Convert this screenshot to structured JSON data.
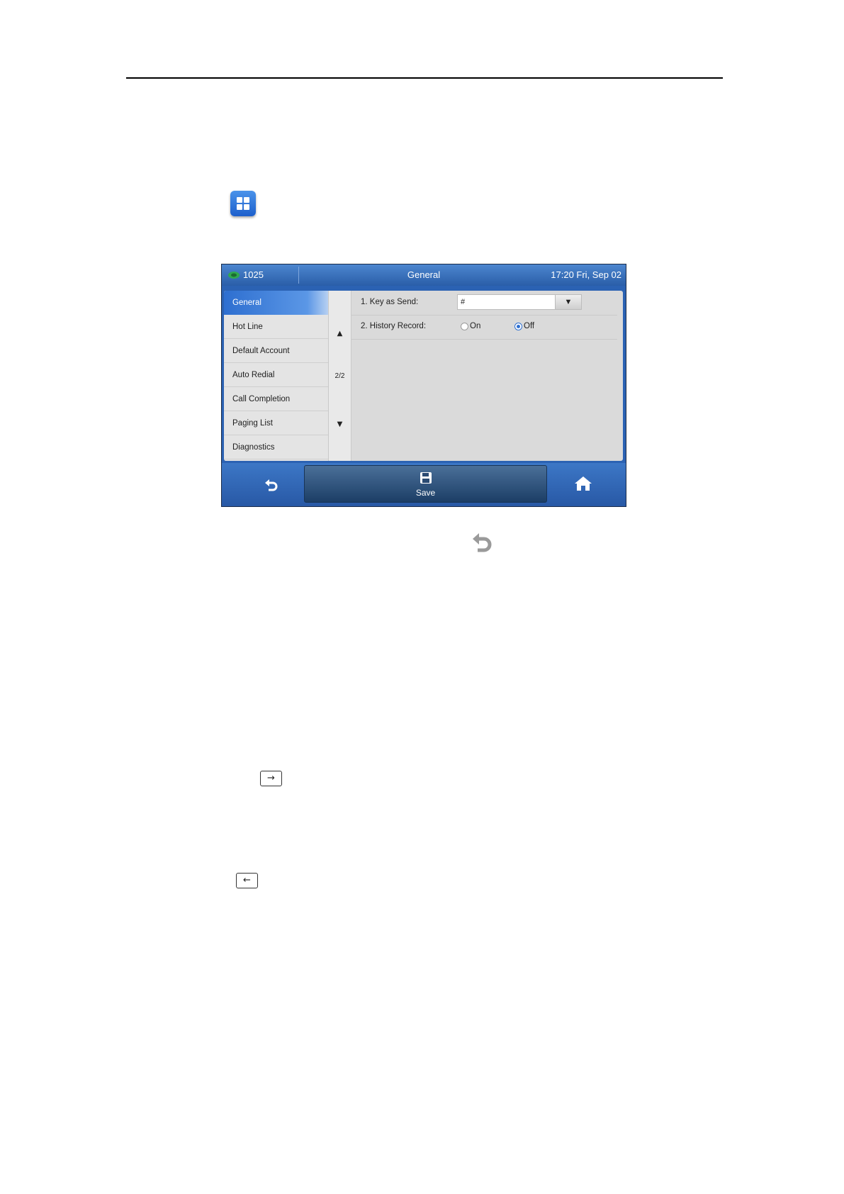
{
  "phone": {
    "account": "1025",
    "title": "General",
    "datetime": "17:20 Fri, Sep 02",
    "sidebar": [
      {
        "label": "General",
        "active": true
      },
      {
        "label": "Hot Line",
        "active": false
      },
      {
        "label": "Default Account",
        "active": false
      },
      {
        "label": "Auto Redial",
        "active": false
      },
      {
        "label": "Call Completion",
        "active": false
      },
      {
        "label": "Paging List",
        "active": false
      },
      {
        "label": "Diagnostics",
        "active": false
      }
    ],
    "scroll": {
      "up": "▲",
      "page": "2/2",
      "down": "▼"
    },
    "settings": {
      "key_as_send": {
        "label": "1. Key as Send:",
        "value": "#",
        "arrow": "▼"
      },
      "history_record": {
        "label": "2. History Record:",
        "options": [
          "On",
          "Off"
        ],
        "selected": "Off"
      }
    },
    "softkeys": {
      "back_icon": "back-arrow-icon",
      "save": "Save",
      "save_icon": "floppy-disk-icon",
      "home_icon": "home-icon"
    }
  },
  "doc": {
    "menu_icon": "menu-grid-icon",
    "back_icon": "back-arrow-icon",
    "key_right": "→",
    "key_left": "←"
  },
  "colors": {
    "accent": "#2e6fd0",
    "titlebar": "#3a72bf",
    "panel": "#dadada"
  }
}
